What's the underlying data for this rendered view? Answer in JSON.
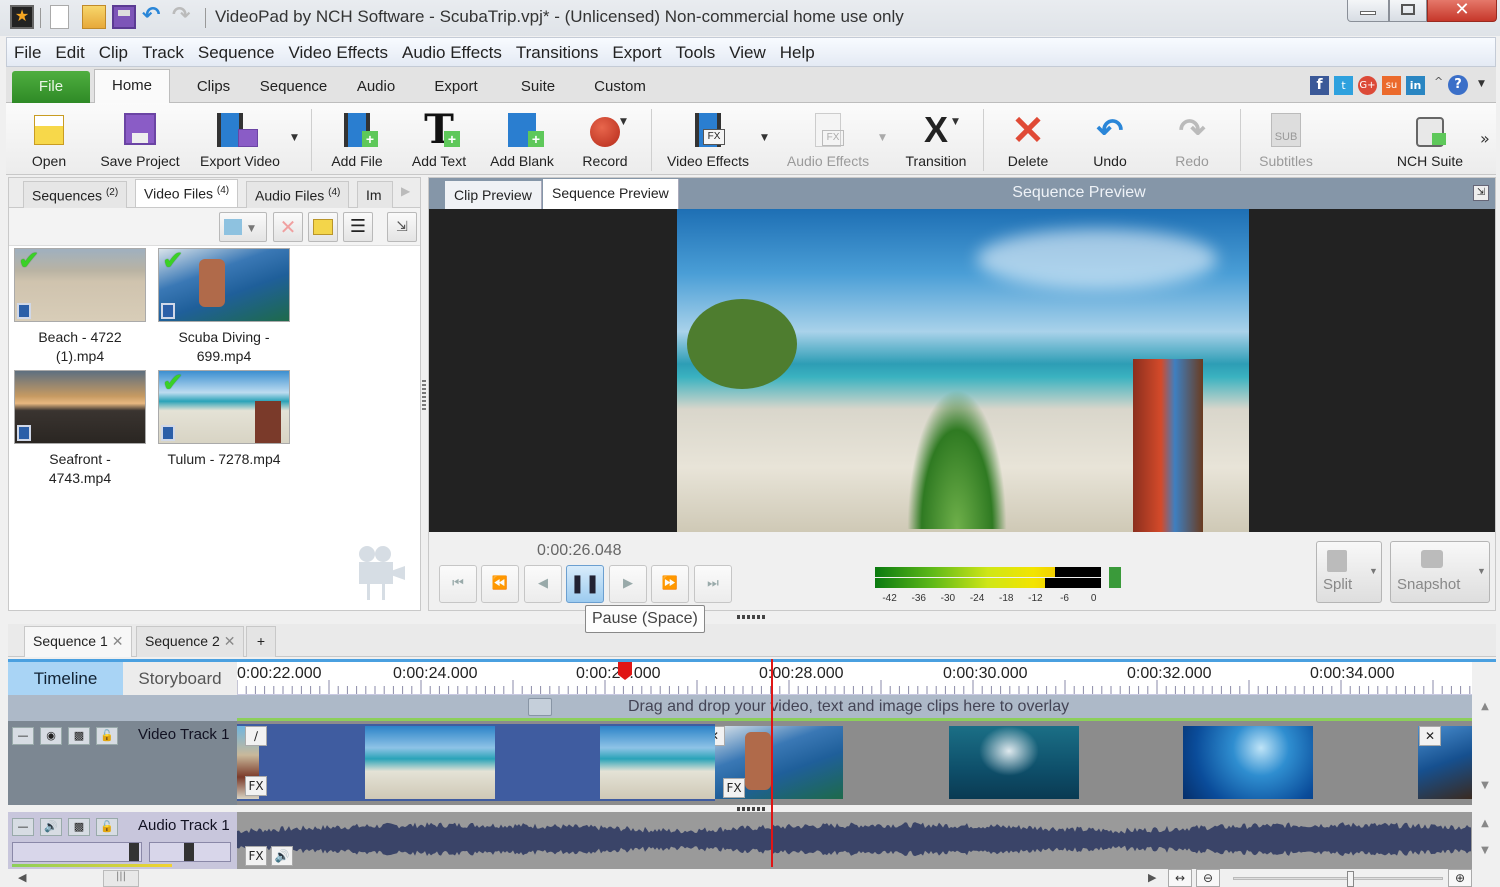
{
  "window": {
    "title": "VideoPad by NCH Software - ScubaTrip.vpj* - (Unlicensed) Non-commercial home use only",
    "controls": [
      "minimize",
      "maximize",
      "close"
    ]
  },
  "quick_access": [
    "app-icon",
    "new-project-icon",
    "open-project-icon",
    "save-icon",
    "undo-icon",
    "redo-icon"
  ],
  "menu": [
    "File",
    "Edit",
    "Clip",
    "Track",
    "Sequence",
    "Video Effects",
    "Audio Effects",
    "Transitions",
    "Export",
    "Tools",
    "View",
    "Help"
  ],
  "ribbon_tabs": [
    "File",
    "Home",
    "Clips",
    "Sequence",
    "Audio",
    "Export",
    "Suite",
    "Custom"
  ],
  "ribbon_active_tab": "Home",
  "social": [
    "facebook",
    "twitter",
    "google-plus",
    "stumbleupon",
    "linkedin"
  ],
  "ribbon_buttons": [
    {
      "label": "Open",
      "icon": "folder-open-icon",
      "enabled": true
    },
    {
      "label": "Save Project",
      "icon": "save-project-icon",
      "enabled": true
    },
    {
      "label": "Export Video",
      "icon": "export-video-icon",
      "enabled": true,
      "dropdown": true
    },
    {
      "label": "Add File",
      "icon": "add-file-icon",
      "enabled": true
    },
    {
      "label": "Add Text",
      "icon": "add-text-icon",
      "enabled": true
    },
    {
      "label": "Add Blank",
      "icon": "add-blank-icon",
      "enabled": true
    },
    {
      "label": "Record",
      "icon": "record-icon",
      "enabled": true,
      "dropdown": true
    },
    {
      "label": "Video Effects",
      "icon": "video-effects-icon",
      "enabled": true,
      "dropdown": true
    },
    {
      "label": "Audio Effects",
      "icon": "audio-effects-icon",
      "enabled": false,
      "dropdown": true
    },
    {
      "label": "Transition",
      "icon": "transition-icon",
      "enabled": true,
      "dropdown": true
    },
    {
      "label": "Delete",
      "icon": "delete-icon",
      "enabled": true
    },
    {
      "label": "Undo",
      "icon": "undo-icon",
      "enabled": true
    },
    {
      "label": "Redo",
      "icon": "redo-icon",
      "enabled": false
    },
    {
      "label": "Subtitles",
      "icon": "subtitles-icon",
      "enabled": false
    },
    {
      "label": "NCH Suite",
      "icon": "nch-suite-icon",
      "enabled": true
    }
  ],
  "bin": {
    "tabs": [
      {
        "label": "Sequences",
        "count": "(2)"
      },
      {
        "label": "Video Files",
        "count": "(4)",
        "active": true
      },
      {
        "label": "Audio Files",
        "count": "(4)"
      },
      {
        "label": "Im",
        "count": ""
      }
    ],
    "files": [
      {
        "name_line1": "Beach - 4722",
        "name_line2": "(1).mp4",
        "used": true
      },
      {
        "name_line1": "Scuba Diving -",
        "name_line2": "699.mp4",
        "used": true
      },
      {
        "name_line1": "Seafront -",
        "name_line2": "4743.mp4",
        "used": false
      },
      {
        "name_line1": "Tulum - 7278.mp4",
        "name_line2": "",
        "used": true
      }
    ]
  },
  "preview": {
    "tabs": [
      "Clip Preview",
      "Sequence Preview"
    ],
    "active_tab": "Sequence Preview",
    "title": "Sequence Preview",
    "time": "0:00:26.048",
    "transport": [
      "skip-to-start",
      "previous-frame-group",
      "step-back",
      "pause",
      "step-forward",
      "next-frame-group",
      "skip-to-end"
    ],
    "tooltip": "Pause (Space)",
    "meter_ticks": [
      "-42",
      "-36",
      "-30",
      "-24",
      "-18",
      "-12",
      "-6",
      "0"
    ],
    "meter_level_left_db": -8,
    "meter_level_right_db": -10,
    "split_label": "Split",
    "snapshot_label": "Snapshot"
  },
  "sequences": {
    "tabs": [
      "Sequence 1",
      "Sequence 2"
    ],
    "active": "Sequence 1",
    "add_label": "+"
  },
  "timeline": {
    "mode_timeline": "Timeline",
    "mode_storyboard": "Storyboard",
    "ruler_labels": [
      "0:00:22.000",
      "0:00:24.000",
      "0:00:26.000",
      "0:00:28.000",
      "0:00:30.000",
      "0:00:32.000",
      "0:00:34.000"
    ],
    "overlay_hint": "Drag and drop your video, text and image clips here to overlay",
    "video_track": "Video Track 1",
    "audio_track": "Audio Track 1",
    "playhead_time": "0:00:26.048"
  },
  "colors": {
    "accent_green": "#3a9a2e",
    "playhead": "#e01515",
    "selected_clip": "#3f5ca0",
    "timeline_mode_active": "#a9d4f5"
  }
}
